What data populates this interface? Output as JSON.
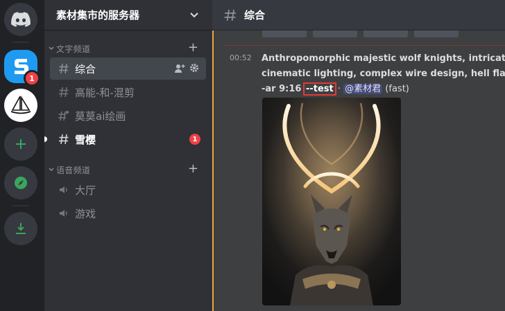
{
  "rail": {
    "badges": {
      "server1": "1"
    }
  },
  "server": {
    "name": "素材集市的服务器"
  },
  "categories": {
    "text": "文字频道",
    "voice": "语音频道"
  },
  "text_channels": [
    {
      "name": "综合"
    },
    {
      "name": "高能-和-混剪"
    },
    {
      "name": "莫莫ai绘画"
    },
    {
      "name": "雪樱",
      "badge": "1"
    }
  ],
  "voice_channels": [
    {
      "name": "大厅"
    },
    {
      "name": "游戏"
    }
  ],
  "channel": {
    "title": "综合"
  },
  "message": {
    "time": "00:52",
    "line1": "Anthropomorphic majestic wolf knights, intricate do",
    "line2": "cinematic lighting, complex wire design, hell flames",
    "line3_prefix": "-ar 9:16 ",
    "flag": "--test",
    "sep": " · ",
    "mention": "@素材君",
    "mode": " (fast)"
  },
  "colors": {
    "accent": "#5865f2",
    "badge": "#ed4245",
    "green": "#3ba55d",
    "highlight": "#e53935"
  }
}
